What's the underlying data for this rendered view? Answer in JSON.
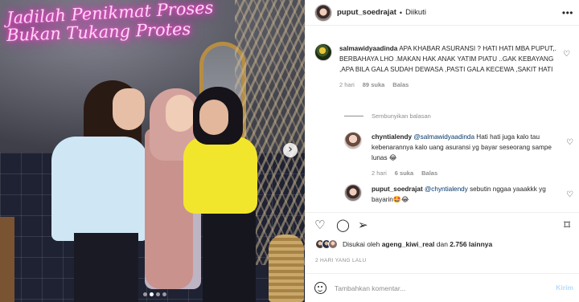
{
  "photo": {
    "neon_line_1": "Jadilah Penikmat Proses",
    "neon_line_2": "Bukan Tukang Protes",
    "next_icon": "chevron-right-icon",
    "dots_count": 4,
    "active_dot": 1
  },
  "header": {
    "username": "puput_soedrajat",
    "separator": "•",
    "follow_status": "Diikuti",
    "more_icon": "more-horizontal-icon"
  },
  "comments": [
    {
      "username": "salmawidyaadinda",
      "text": "APA KHABAR ASURANSI ? HATI HATI MBA PUPUT,. BERBAHAYA LHO .MAKAN HAK ANAK YATIM PIATU ..GAK KEBAYANG ,APA BILA GALA SUDAH DEWASA ,PASTI GALA KECEWA ,SAKIT HATI",
      "time": "2 hari",
      "likes": "89 suka",
      "reply": "Balas"
    },
    {
      "username": "chyntialendy",
      "mention": "@salmawidyaadinda",
      "text": " Hati hati juga kalo tau kebenarannya kalo uang asuransi yg bayar seseorang sampe lunas 😂",
      "time": "2 hari",
      "likes": "6 suka",
      "reply": "Balas"
    },
    {
      "username": "puput_soedrajat",
      "mention": "@chyntialendy",
      "text": " sebutin nggaa yaaakkk yg bayarin🤩😂"
    }
  ],
  "hide_replies": "Sembunyikan balasan",
  "actions": {
    "like_icon": "heart-icon",
    "comment_icon": "comment-icon",
    "share_icon": "send-icon",
    "save_icon": "bookmark-icon"
  },
  "likes": {
    "prefix": "Disukai oleh",
    "user": "ageng_kiwi_real",
    "connector": "dan",
    "count": "2.756 lainnya"
  },
  "posted_time": "2 HARI YANG LALU",
  "add_comment": {
    "placeholder": "Tambahkan komentar...",
    "post_label": "Kirim",
    "emoji_icon": "emoji-icon"
  },
  "colors": {
    "mention": "#00376b",
    "muted": "#8e8e8e",
    "post_button": "#b3dbff"
  }
}
